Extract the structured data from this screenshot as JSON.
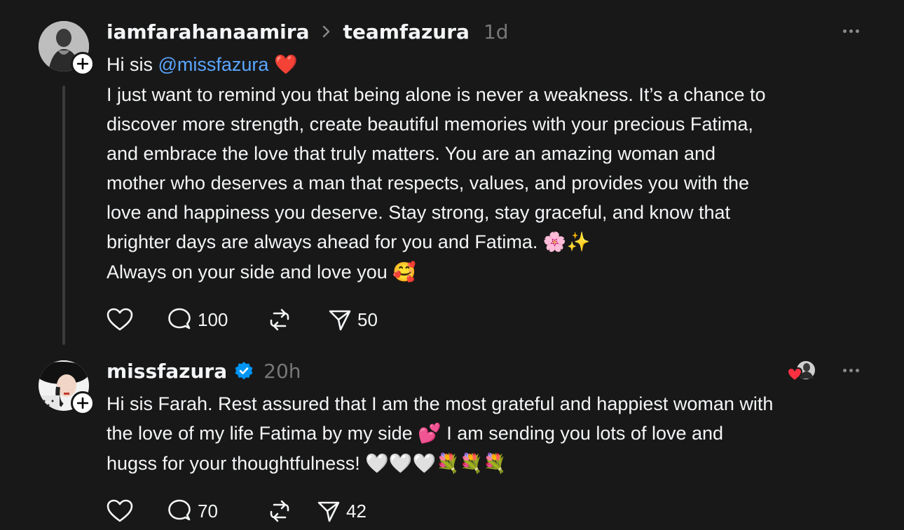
{
  "post1": {
    "username": "iamfarahanaamira",
    "reply_to": "teamfazura",
    "time": "1d",
    "greeting": "Hi sis ",
    "mention": "@missfazura",
    "greeting_emoji": "❤️",
    "lines": [
      "I just want to remind you that being alone is never a weakness. It’s a chance to",
      "discover more strength, create beautiful memories with your precious Fatima,",
      "and embrace the love that truly matters. You are an amazing woman and",
      "mother who deserves a man that respects, values, and provides you with the",
      "love and happiness you deserve. Stay strong, stay graceful, and know that"
    ],
    "line6": "brighter days are always ahead for you and Fatima. ",
    "line6_emoji": "🌸✨",
    "line7": "Always on your side and love you ",
    "line7_emoji": "🥰",
    "like_icon": "heart-icon",
    "comment_count": "100",
    "repost_icon": "repost-icon",
    "share_count": "50"
  },
  "post2": {
    "username": "missfazura",
    "verified_icon": "verified-badge-icon",
    "time": "20h",
    "line1": "Hi sis Farah. Rest assured that I am the most grateful and happiest woman with",
    "line2": "the love of my life Fatima by my side ",
    "line2_emoji": "💕",
    "line2_rest": " I am sending you lots of love and",
    "line3": "hugss for your thoughtfulness! ",
    "line3_emoji": "🤍🤍🤍💐💐💐",
    "comment_count": "70",
    "share_count": "42"
  },
  "colors": {
    "background": "#181818",
    "text": "#f3f5f7",
    "muted": "#777777",
    "mention": "#5aa6ff",
    "verified": "#0095f6",
    "liked_heart": "#ff3040"
  }
}
